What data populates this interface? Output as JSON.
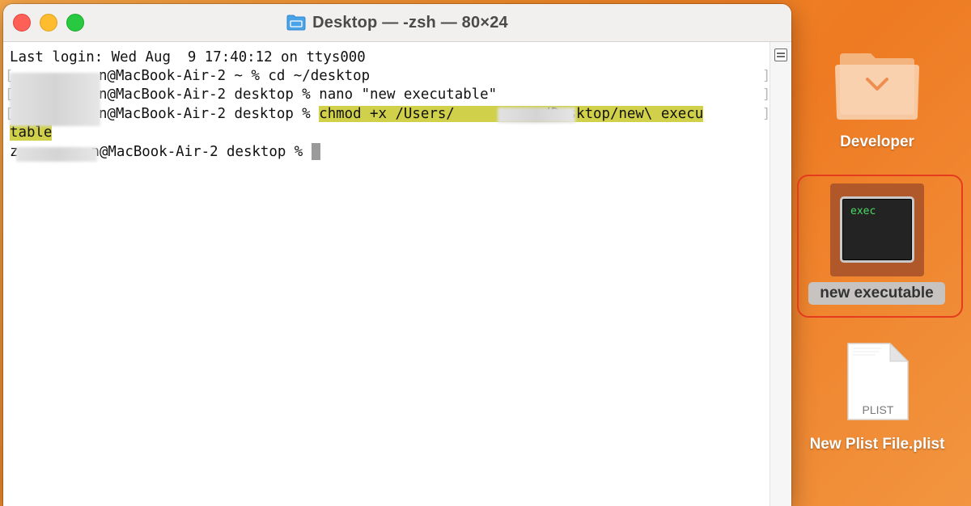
{
  "window": {
    "title": "Desktop — -zsh — 80×24"
  },
  "terminal": {
    "lines": [
      "Last login: Wed Aug  9 17:40:12 on ttys000",
      "n@MacBook-Air-2 ~ % cd ~/desktop",
      "n@MacBook-Air-2 desktop % nano \"new executable\"",
      "n@MacBook-Air-2 desktop % "
    ],
    "highlighted_cmd_part1": "chmod +x /Users/",
    "highlighted_cmd_part2": "n/Desktop/new\\ execu",
    "highlighted_wrap": "table",
    "last_prompt_prefix": "z",
    "last_prompt": "n@MacBook-Air-2 desktop % "
  },
  "desktop": {
    "items": [
      {
        "label": "Developer",
        "icon": "folder-icon"
      },
      {
        "label": "new executable",
        "icon": "exec-icon",
        "icon_text": "exec",
        "selected": true
      },
      {
        "label": "New Plist File.plist",
        "icon": "plist-icon",
        "icon_text": "PLIST"
      }
    ]
  },
  "colors": {
    "highlight": "#d0d04a",
    "selection_outline": "#e53b1f",
    "exec_text": "#4cd964"
  }
}
